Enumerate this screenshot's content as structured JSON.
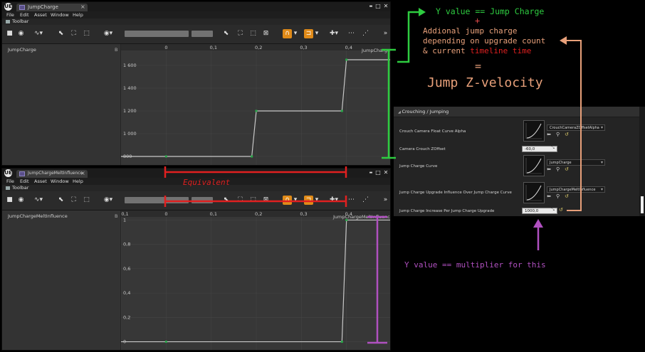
{
  "app": {
    "logo": "UE"
  },
  "window_top": {
    "tab_title": "JumpCharge",
    "tab_close": "×",
    "menu": [
      "File",
      "Edit",
      "Asset",
      "Window",
      "Help"
    ],
    "toolbar_tab": "Toolbar",
    "track_name": "JumpCharge",
    "track_b": "B",
    "curve_label": "JumpCharge",
    "x_ticks": [
      "0",
      "0,1",
      "0,2",
      "0,3",
      "0,4"
    ],
    "y_ticks": [
      "1 600",
      "1 400",
      "1 200",
      "1 000",
      "800"
    ]
  },
  "window_bottom": {
    "tab_title": "JumpChargeMeltInfluence",
    "tab_close": "×",
    "menu": [
      "File",
      "Edit",
      "Asset",
      "Window",
      "Help"
    ],
    "toolbar_tab": "Toolbar",
    "track_name": "JumpChargeMeltInfluence",
    "track_b": "B",
    "curve_label": "JumpChargeMeltInfluence",
    "x_ticks": [
      "-0,1",
      "0",
      "0,1",
      "0,2",
      "0,3",
      "0,4"
    ],
    "y_ticks": [
      "1",
      "0,8",
      "0,6",
      "0,4",
      "0,2",
      "0"
    ]
  },
  "window_controls": {
    "minimize": "▬",
    "maximize": "□",
    "close": "✕"
  },
  "details": {
    "section_title": "Crouching / Jumping",
    "rows": [
      {
        "label": "Crouch Camera Float Curve Alpha",
        "value": "CrouchCameraZOffsetAlpha"
      },
      {
        "label": "Camera Crouch ZOffset",
        "value": "-60,0"
      },
      {
        "label": "Jump Charge Curve",
        "value": "JumpCharge"
      },
      {
        "label": "Jump Charge Upgrade Influence Over Jump Charge Curve",
        "value": "JumpChargeMeltInfluence"
      },
      {
        "label": "Jump Charge Increase Per Jump Charge Upgrade",
        "value": "1000,0"
      }
    ]
  },
  "annotations": {
    "top_line": "Y value == Jump Charge",
    "plus": "+",
    "line2": "Addional jump charge",
    "line3": "depending on upgrade count",
    "line4_a": "& current ",
    "line4_b": "timeline time",
    "equals": "=",
    "result": "Jump Z-velocity",
    "equivalent": "Equivalent",
    "multiplier": "Y value == multiplier for this"
  },
  "colors": {
    "green": "#2ecc40",
    "red": "#e02020",
    "orange": "#e8a07a",
    "purple": "#b050c0",
    "curve": "#c8c8c8",
    "key": "#2aa84a"
  },
  "chart_data": [
    {
      "type": "line",
      "x": [
        0,
        0.19,
        0.2,
        0.39,
        0.4
      ],
      "y": [
        800,
        800,
        1200,
        1200,
        1650
      ],
      "xlim": [
        -0.1,
        0.5
      ],
      "ylim": [
        750,
        1700
      ]
    },
    {
      "type": "line",
      "x": [
        0,
        0.39,
        0.4
      ],
      "y": [
        0,
        0,
        1
      ],
      "xlim": [
        -0.1,
        0.5
      ],
      "ylim": [
        -0.02,
        1.02
      ]
    }
  ]
}
